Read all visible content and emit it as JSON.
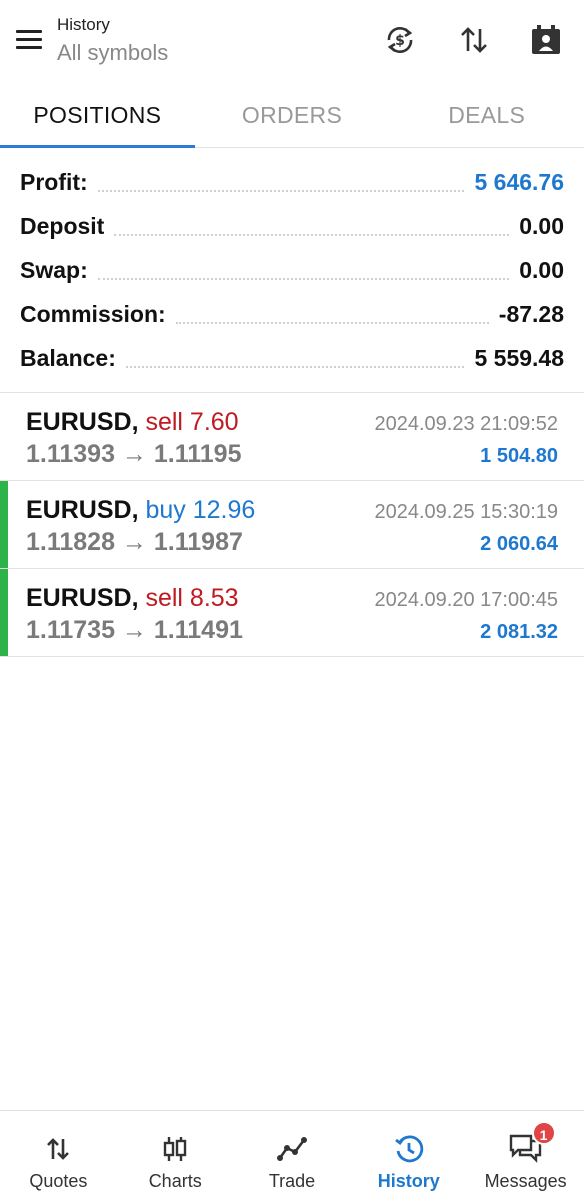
{
  "header": {
    "title": "History",
    "subtitle": "All symbols"
  },
  "tabs": [
    {
      "label": "POSITIONS",
      "active": true
    },
    {
      "label": "ORDERS",
      "active": false
    },
    {
      "label": "DEALS",
      "active": false
    }
  ],
  "summary": {
    "profit_label": "Profit:",
    "profit_value": "5 646.76",
    "deposit_label": "Deposit",
    "deposit_value": "0.00",
    "swap_label": "Swap:",
    "swap_value": "0.00",
    "commission_label": "Commission:",
    "commission_value": "-87.28",
    "balance_label": "Balance:",
    "balance_value": "5 559.48"
  },
  "positions": [
    {
      "symbol": "EURUSD,",
      "type": "sell 7.60",
      "prices": "1.11393 → 1.11195",
      "time": "2024.09.23 21:09:52",
      "profit": "1 504.80"
    },
    {
      "symbol": "EURUSD,",
      "type": "buy 12.96",
      "prices": "1.11828 → 1.11987",
      "time": "2024.09.25 15:30:19",
      "profit": "2 060.64"
    },
    {
      "symbol": "EURUSD,",
      "type": "sell 8.53",
      "prices": "1.11735 → 1.11491",
      "time": "2024.09.20 17:00:45",
      "profit": "2 081.32"
    }
  ],
  "nav": {
    "quotes": "Quotes",
    "charts": "Charts",
    "trade": "Trade",
    "history": "History",
    "messages": "Messages",
    "messages_badge": "1"
  },
  "colors": {
    "accent": "#1e78d0",
    "sell": "#c0191f",
    "profit_bar": "#2eb34a"
  },
  "icons": [
    "menu-icon",
    "sync-icon",
    "sort-icon",
    "calendar-icon",
    "quotes-icon",
    "charts-icon",
    "trade-icon",
    "history-icon",
    "messages-icon"
  ]
}
